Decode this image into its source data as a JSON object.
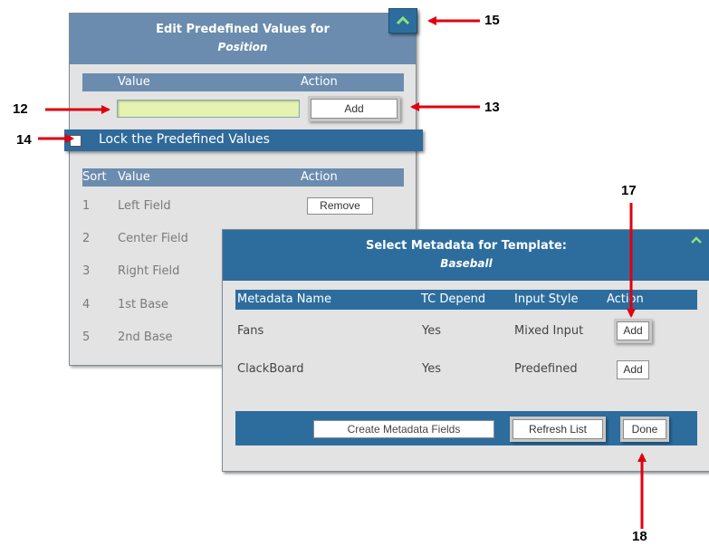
{
  "colors": {
    "header": "#6b8cae",
    "header_dark": "#2d6d9e",
    "panel_bg": "#e3e3e3",
    "input_bg": "#e6f3b0",
    "arrow": "#e0000f"
  },
  "edit_panel": {
    "title": "Edit Predefined Values for",
    "subtitle": "Position",
    "value_header": "Value",
    "action_header": "Action",
    "value_input": "",
    "add_label": "Add",
    "lock_label": "Lock the Predefined Values",
    "lock_checked": false,
    "collapse_icon": "chevron-up-icon",
    "list_headers": {
      "sort": "Sort",
      "value": "Value",
      "action": "Action"
    },
    "rows": [
      {
        "sort": "1",
        "value": "Left Field",
        "action": "Remove"
      },
      {
        "sort": "2",
        "value": "Center Field"
      },
      {
        "sort": "3",
        "value": "Right Field"
      },
      {
        "sort": "4",
        "value": "1st Base"
      },
      {
        "sort": "5",
        "value": "2nd Base"
      }
    ]
  },
  "metadata_panel": {
    "title": "Select Metadata for Template:",
    "subtitle": "Baseball",
    "collapse_icon": "chevron-up-icon",
    "headers": {
      "name": "Metadata Name",
      "tc": "TC Depend",
      "style": "Input Style",
      "action": "Action"
    },
    "rows": [
      {
        "name": "Fans",
        "tc": "Yes",
        "style": "Mixed Input",
        "action": "Add"
      },
      {
        "name": "ClackBoard",
        "tc": "Yes",
        "style": "Predefined",
        "action": "Add"
      }
    ],
    "create_label": "Create Metadata Fields",
    "refresh_label": "Refresh List",
    "done_label": "Done"
  },
  "callouts": {
    "c12": "12",
    "c13": "13",
    "c14": "14",
    "c15": "15",
    "c17": "17",
    "c18": "18"
  }
}
